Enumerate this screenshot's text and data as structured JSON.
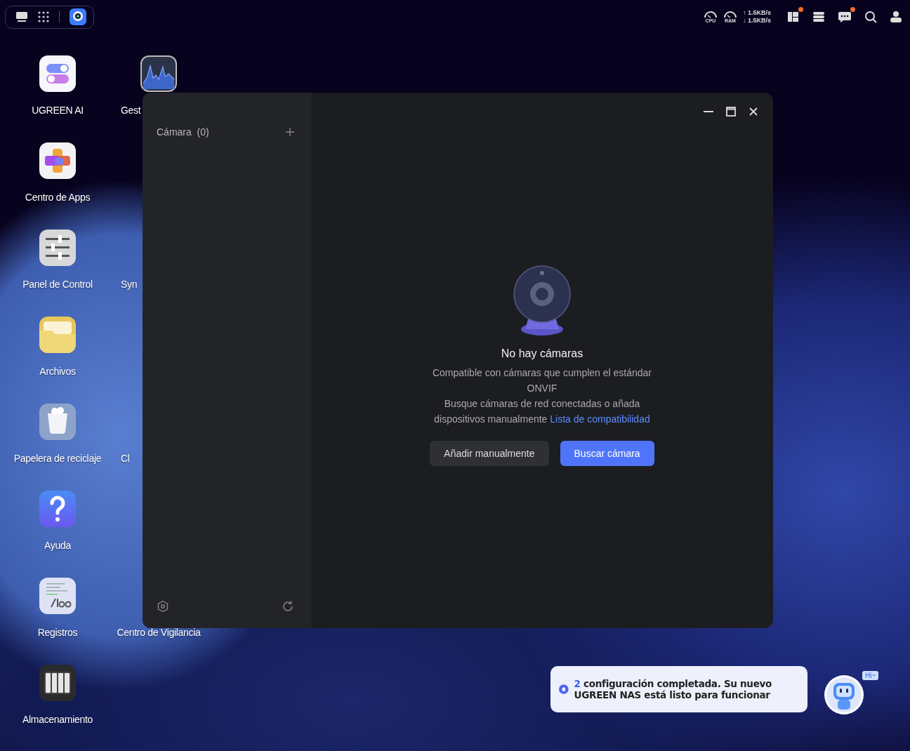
{
  "top_bar": {
    "tray": [
      {
        "label": "CPU"
      },
      {
        "label": "RAM"
      }
    ],
    "network": {
      "upload": "↑ 1.5KB/s",
      "download": "↓ 1.5KB/s"
    },
    "icons": [
      {
        "kind": "widgets",
        "badge": true
      },
      {
        "kind": "server",
        "badge": false
      },
      {
        "kind": "chat",
        "badge": true
      },
      {
        "kind": "search",
        "badge": false
      },
      {
        "kind": "user",
        "badge": false
      }
    ]
  },
  "desktop_icons": [
    {
      "kind": "ai",
      "label": "UGREEN AI"
    },
    {
      "kind": "apps",
      "label": "Centro de Apps"
    },
    {
      "kind": "control",
      "label": "Panel de Control"
    },
    {
      "kind": "files",
      "label": "Archivos"
    },
    {
      "kind": "trash",
      "label": "Papelera de reciclaje"
    },
    {
      "kind": "help",
      "label": "Ayuda"
    },
    {
      "kind": "logs",
      "label": "Registros"
    },
    {
      "kind": "storage",
      "label": "Almacenamiento"
    },
    {
      "kind": "monitor",
      "label": "Gest"
    },
    {
      "kind": "hidden"
    },
    {
      "kind": "hidden",
      "label": "Syn"
    },
    {
      "kind": "hidden"
    },
    {
      "kind": "hidden",
      "label": "Cl"
    },
    {
      "kind": "hidden"
    },
    {
      "kind": "covered",
      "label": "Centro de Vigilancia"
    }
  ],
  "window": {
    "sidebar": {
      "title": "Cámara",
      "count": "(0)"
    },
    "empty_state": {
      "title": "No hay cámaras",
      "text_1": "Compatible con cámaras que cumplen el estándar ONVIF",
      "text_2": "Busque cámaras de red conectadas o añada dispositivos manualmente",
      "link": "Lista de compatibilidad",
      "buttons": [
        {
          "label": "Añadir manualmente",
          "kind": "secondary"
        },
        {
          "label": "Buscar cámara",
          "kind": "primary"
        }
      ]
    }
  },
  "notification": {
    "count": "2",
    "message": "configuración completada. Su nuevo UGREEN NAS está listo para funcionar"
  },
  "assistant": {
    "greeting": "Hi~"
  }
}
